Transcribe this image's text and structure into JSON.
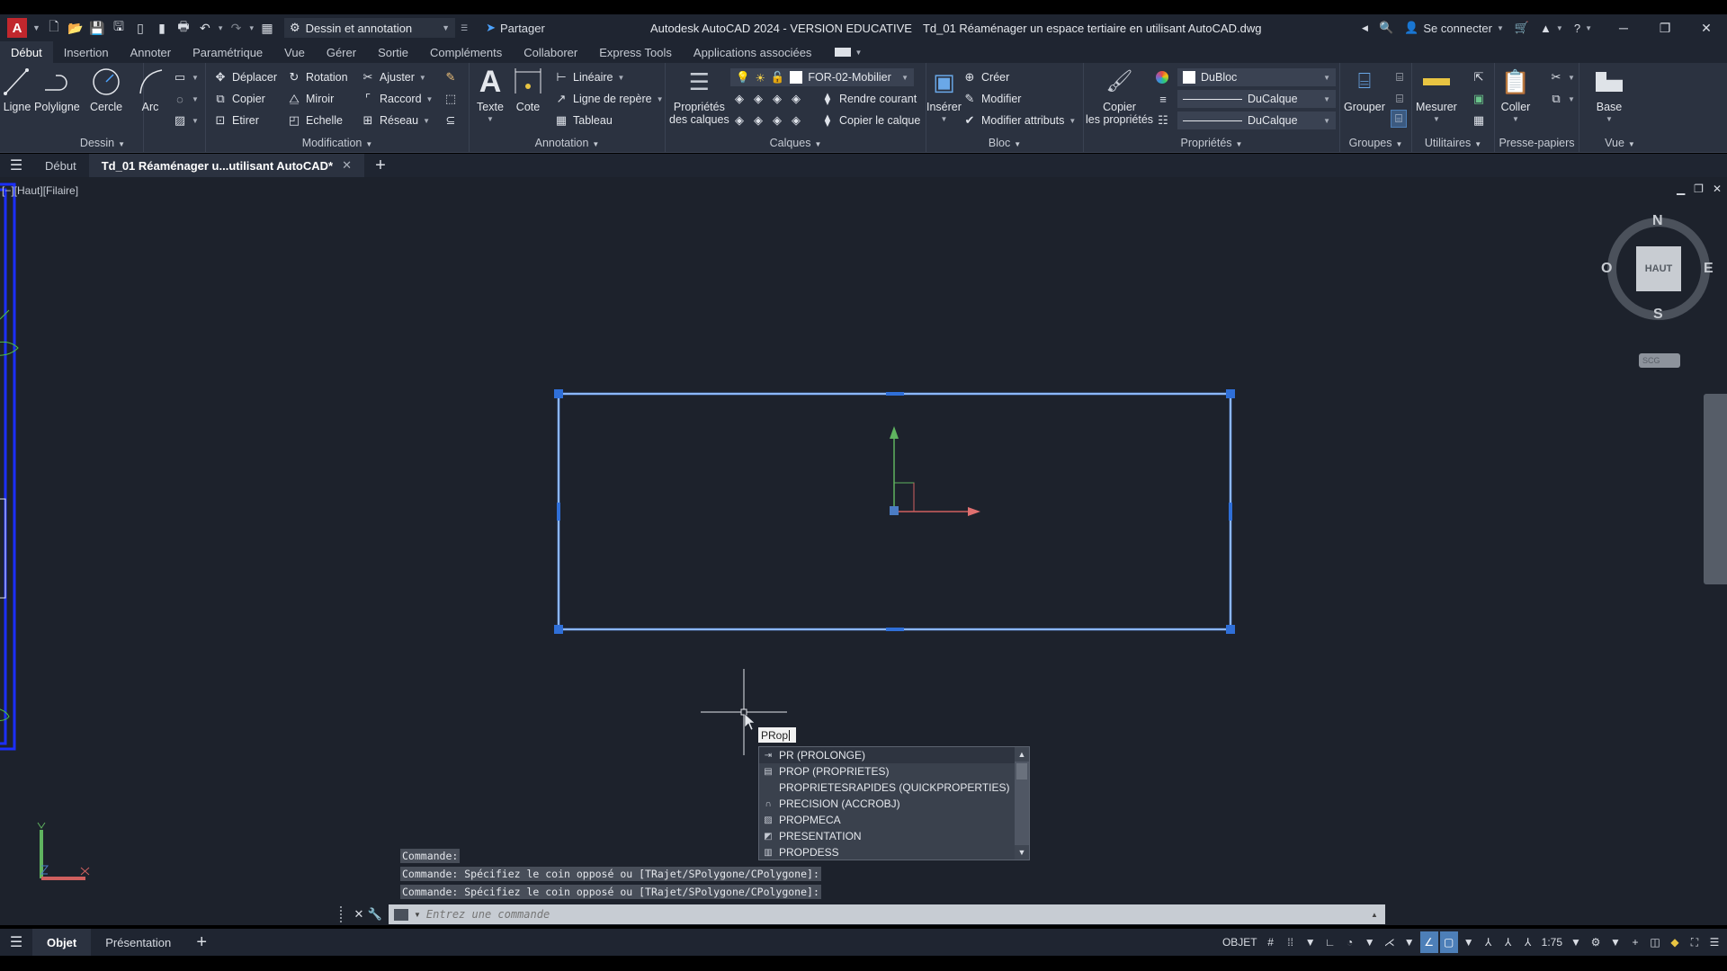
{
  "titlebar": {
    "app_logo": "A",
    "workspace": "Dessin et annotation",
    "share": "Partager",
    "app_title": "Autodesk AutoCAD 2024 - VERSION EDUCATIVE",
    "file_title": "Td_01 Réaménager un espace tertiaire en utilisant AutoCAD.dwg",
    "sign_in": "Se connecter",
    "qat_icons": [
      "new-icon",
      "open-icon",
      "save-icon",
      "save-as-icon",
      "open-web-icon",
      "save-web-icon",
      "plot-icon",
      "undo-icon",
      "redo-icon",
      "app-icon"
    ]
  },
  "ribbon_tabs": [
    "Début",
    "Insertion",
    "Annoter",
    "Paramétrique",
    "Vue",
    "Gérer",
    "Sortie",
    "Compléments",
    "Collaborer",
    "Express Tools",
    "Applications associées"
  ],
  "ribbon_active_tab": "Début",
  "ribbon": {
    "dessin": {
      "title": "Dessin",
      "ligne": "Ligne",
      "polyligne": "Polyligne",
      "cercle": "Cercle",
      "arc": "Arc"
    },
    "modification": {
      "title": "Modification",
      "deplacer": "Déplacer",
      "rotation": "Rotation",
      "ajuster": "Ajuster",
      "copier": "Copier",
      "miroir": "Miroir",
      "raccord": "Raccord",
      "etirer": "Etirer",
      "echelle": "Echelle",
      "reseau": "Réseau"
    },
    "annotation": {
      "title": "Annotation",
      "texte": "Texte",
      "cote": "Cote",
      "lineaire": "Linéaire",
      "ligne_repere": "Ligne de repère",
      "tableau": "Tableau"
    },
    "calques": {
      "title": "Calques",
      "proprietes_1": "Propriétés",
      "proprietes_2": "des calques",
      "current_layer": "FOR-02-Mobilier",
      "rendre_courant": "Rendre courant",
      "copier_calque": "Copier le calque"
    },
    "bloc": {
      "title": "Bloc",
      "inserer": "Insérer",
      "creer": "Créer",
      "modifier": "Modifier",
      "modifier_attributs": "Modifier attributs"
    },
    "proprietes": {
      "title": "Propriétés",
      "copier_1": "Copier",
      "copier_2": "les propriétés",
      "color": "DuBloc",
      "lineweight": "DuCalque",
      "linetype": "DuCalque"
    },
    "groupes": {
      "title": "Groupes",
      "grouper": "Grouper"
    },
    "utilitaires": {
      "title": "Utilitaires",
      "mesurer": "Mesurer"
    },
    "presse_papiers": {
      "title": "Presse-papiers",
      "coller": "Coller"
    },
    "vue": {
      "title": "Vue",
      "base": "Base"
    }
  },
  "doc_tabs": {
    "start": "Début",
    "active": "Td_01 Réaménager u...utilisant AutoCAD*"
  },
  "viewport": {
    "label": "[−][Haut][Filaire]",
    "viewcube": {
      "face": "HAUT",
      "n": "N",
      "s": "S",
      "e": "E",
      "w": "O"
    },
    "wcs": "SCG"
  },
  "autocomplete": {
    "typed": "PRop",
    "items": [
      {
        "label": "PR (PROLONGE)",
        "icon": "extend-icon"
      },
      {
        "label": "PROP (PROPRIETES)",
        "icon": "properties-icon"
      },
      {
        "label": "PROPRIETESRAPIDES (QUICKPROPERTIES)",
        "icon": ""
      },
      {
        "label": "PRECISION (ACCROBJ)",
        "icon": "osnap-magnet-icon"
      },
      {
        "label": "PROPMECA",
        "icon": "massprop-icon"
      },
      {
        "label": "PRESENTATION",
        "icon": "layout-icon"
      },
      {
        "label": "PROPDESS",
        "icon": "dwgprops-icon"
      }
    ]
  },
  "command_history": [
    "Commande:",
    "Commande: Spécifiez le coin opposé ou [TRajet/SPolygone/CPolygone]:",
    "Commande: Spécifiez le coin opposé ou [TRajet/SPolygone/CPolygone]:"
  ],
  "command_input": {
    "placeholder": "Entrez une commande",
    "value": ""
  },
  "layout_tabs": [
    "Objet",
    "Présentation"
  ],
  "status_bar": {
    "model": "OBJET",
    "scale": "1:75"
  },
  "colors": {
    "selection": "#3f8cff",
    "grip": "#2f6fd8",
    "ucs_x": "#d0605f",
    "ucs_y": "#5fb35f"
  }
}
